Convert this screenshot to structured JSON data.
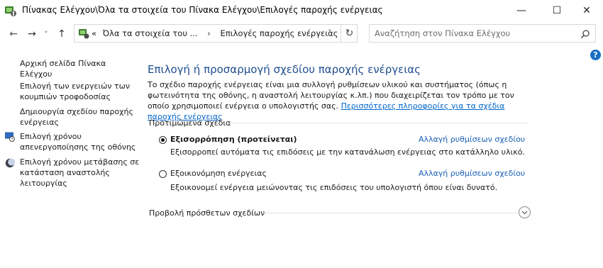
{
  "window": {
    "title": "Πίνακας Ελέγχου\\Όλα τα στοιχεία του Πίνακα Ελέγχου\\Επιλογές παροχής ενέργειας",
    "minimize_glyph": "—",
    "maximize_glyph": "☐",
    "close_glyph": "✕"
  },
  "nav": {
    "back_glyph": "←",
    "forward_glyph": "→",
    "recent_glyph": "˅",
    "up_glyph": "↑",
    "refresh_glyph": "↻",
    "address": {
      "overflow_glyph": "«",
      "crumbs": [
        "Όλα τα στοιχεία του ...",
        "Επιλογές παροχής ενέργειας"
      ],
      "sep_glyph": "›",
      "dropdown_glyph": "˅"
    },
    "search": {
      "placeholder": "Αναζήτηση στον Πίνακα Ελέγχου"
    },
    "help_glyph": "?"
  },
  "sidebar": {
    "home": "Αρχική σελίδα Πίνακα Ελέγχου",
    "items": [
      {
        "label": "Επιλογή των ενεργειών των κουμπιών τροφοδοσίας",
        "icon": "none"
      },
      {
        "label": "Δημιουργία σχεδίου παροχής ενέργειας",
        "icon": "none"
      },
      {
        "label": "Επιλογή χρόνου απενεργοποίησης της οθόνης",
        "icon": "display-clock-icon"
      },
      {
        "label": "Επιλογή χρόνου μετάβασης σε κατάσταση αναστολής λειτουργίας",
        "icon": "moon-icon"
      }
    ]
  },
  "main": {
    "title": "Επιλογή ή προσαρμογή σχεδίου παροχής ενέργειας",
    "description": "Το σχέδιο παροχής ενέργειας είναι μια συλλογή ρυθμίσεων υλικού και συστήματος (όπως η φωτεινότητα της οθόνης, η αναστολή λειτουργίας κ.λπ.) που διαχειρίζεται τον τρόπο με τον οποίο χρησιμοποιεί ενέργεια ο υπολογιστής σας. ",
    "description_link": "Περισσότερες πληροφορίες για τα σχέδια παροχής ενέργειας",
    "preferred_label": "Προτιμώμενα σχέδια",
    "plans": [
      {
        "name": "Εξισορρόπηση (προτείνεται)",
        "selected": true,
        "change_link": "Αλλαγή ρυθμίσεων σχεδίου",
        "description": "Εξισορροπεί αυτόματα τις επιδόσεις με την κατανάλωση ενέργειας στο κατάλληλο υλικό."
      },
      {
        "name": "Εξοικονόμηση ενέργειας",
        "selected": false,
        "change_link": "Αλλαγή ρυθμίσεων σχεδίου",
        "description": "Εξοικονομεί ενέργεια μειώνοντας τις επιδόσεις του υπολογιστή όπου είναι δυνατό."
      }
    ],
    "more_plans_label": "Προβολή πρόσθετων σχεδίων"
  },
  "colors": {
    "title_blue": "#1e4e8c",
    "link_blue": "#1a5fb4",
    "help_blue": "#1a6fc2"
  }
}
